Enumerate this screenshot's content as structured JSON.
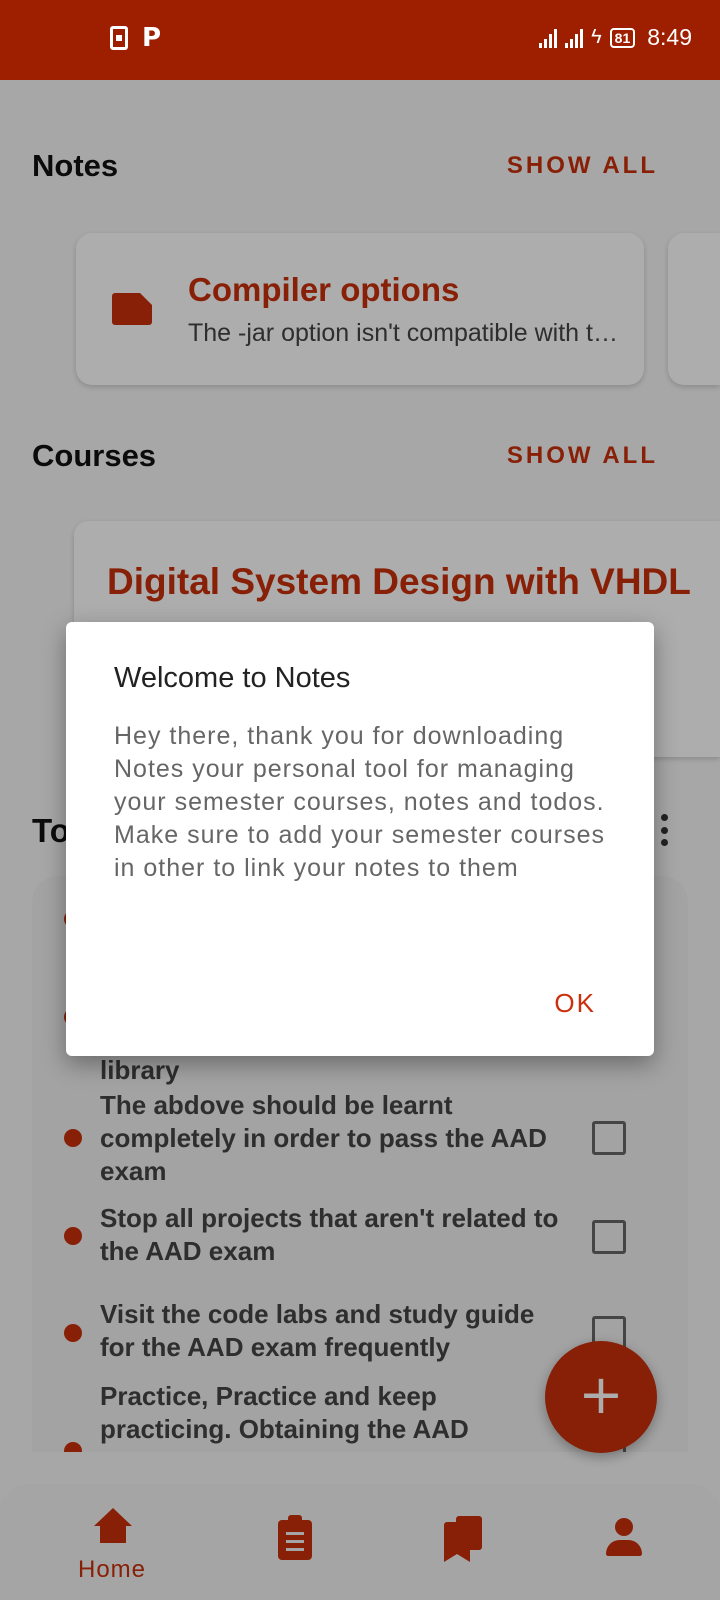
{
  "status_bar": {
    "time": "8:49",
    "battery": "81"
  },
  "notes_section": {
    "title": "Notes",
    "show_all": "SHOW ALL",
    "card": {
      "title": "Compiler options",
      "subtitle": "The -jar option isn't compatible with the other options"
    }
  },
  "courses_section": {
    "title": "Courses",
    "show_all": "SHOW ALL",
    "card": {
      "title": "Digital System Design with VHDL"
    }
  },
  "todos_section": {
    "title": "To",
    "items": [
      {
        "text": "library",
        "checked": false
      },
      {
        "text": "The abdove should be learnt completely in order to pass the AAD exam",
        "checked": false
      },
      {
        "text": "Stop all projects that aren't related to the AAD exam",
        "checked": false
      },
      {
        "text": "Visit the code labs and study guide for the AAD exam frequently",
        "checked": false
      },
      {
        "text": "Practice, Practice and keep practicing. Obtaining the AAD",
        "checked": false
      }
    ]
  },
  "fab": {
    "label": "+"
  },
  "bottom_nav": {
    "items": [
      {
        "label": "Home",
        "icon": "home-icon",
        "active": true
      },
      {
        "label": "",
        "icon": "clipboard-icon",
        "active": false
      },
      {
        "label": "",
        "icon": "bookmarks-icon",
        "active": false
      },
      {
        "label": "",
        "icon": "person-icon",
        "active": false
      }
    ]
  },
  "dialog": {
    "title": "Welcome to Notes",
    "body": "Hey there, thank you for downloading Notes your personal tool for managing your semester courses, notes and todos.\nMake sure to add your semester courses in other to link your notes to them",
    "ok_label": "OK"
  },
  "colors": {
    "accent": "#c9300b",
    "status_bar": "#9e1e00"
  }
}
